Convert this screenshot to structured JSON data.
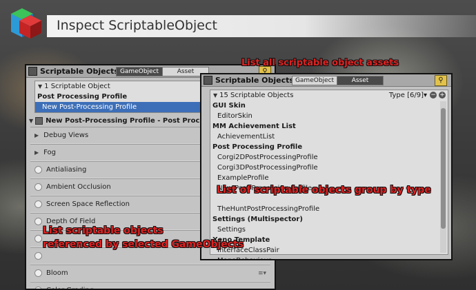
{
  "header": {
    "title": "Inspect ScriptableObject"
  },
  "left_panel": {
    "title": "Scriptable Objects",
    "tab_gameobject": "GameObject",
    "tab_asset": "Asset",
    "count_label": "1 Scriptable Object",
    "category": "Post Processing Profile",
    "selected_item": "New Post-Processing Profile",
    "inspector_title": "New Post-Processing Profile - Post Proc",
    "components": [
      {
        "label": "Debug Views",
        "kind": "fold"
      },
      {
        "label": "Fog",
        "kind": "fold"
      },
      {
        "label": "Antialiasing",
        "kind": "toggle"
      },
      {
        "label": "Ambient Occlusion",
        "kind": "toggle"
      },
      {
        "label": "Screen Space Reflection",
        "kind": "toggle"
      },
      {
        "label": "Depth Of Field",
        "kind": "toggle"
      },
      {
        "label": "",
        "kind": "toggle"
      },
      {
        "label": "",
        "kind": "toggle"
      },
      {
        "label": "Bloom",
        "kind": "toggle"
      },
      {
        "label": "Color Grading",
        "kind": "toggle"
      }
    ]
  },
  "right_panel": {
    "title": "Scriptable Objects",
    "tab_gameobject": "GameObject",
    "tab_asset": "Asset",
    "count_label": "15 Scriptable Objects",
    "type_filter": "Type [6/9]",
    "groups": [
      {
        "name": "GUI Skin",
        "items": [
          "EditorSkin"
        ]
      },
      {
        "name": "MM Achievement List",
        "items": [
          "AchievementList"
        ]
      },
      {
        "name": "Post Processing Profile",
        "items": [
          "Corgi2DPostProcessingProfile",
          "Corgi3DPostProcessingProfile",
          "ExampleProfile",
          "New Post-Processing Profile",
          "",
          "TheHuntPostProcessingProfile"
        ]
      },
      {
        "name": "Settings (Multispector)",
        "items": [
          "Settings"
        ]
      },
      {
        "name": "Xeno Template",
        "items": [
          "InterfaceClassPair",
          "MonoBehaviour"
        ]
      }
    ]
  },
  "annotations": {
    "list_all": "List all scriptable object assets",
    "group_by_type": "List of scriptable objects group by type",
    "referenced_line1": "List scriptable objects",
    "referenced_line2": "referenced by selected GameObjects"
  },
  "colors": {
    "selection": "#3d6fb8",
    "annotation": "#e02222",
    "search_button": "#e2c24a"
  }
}
